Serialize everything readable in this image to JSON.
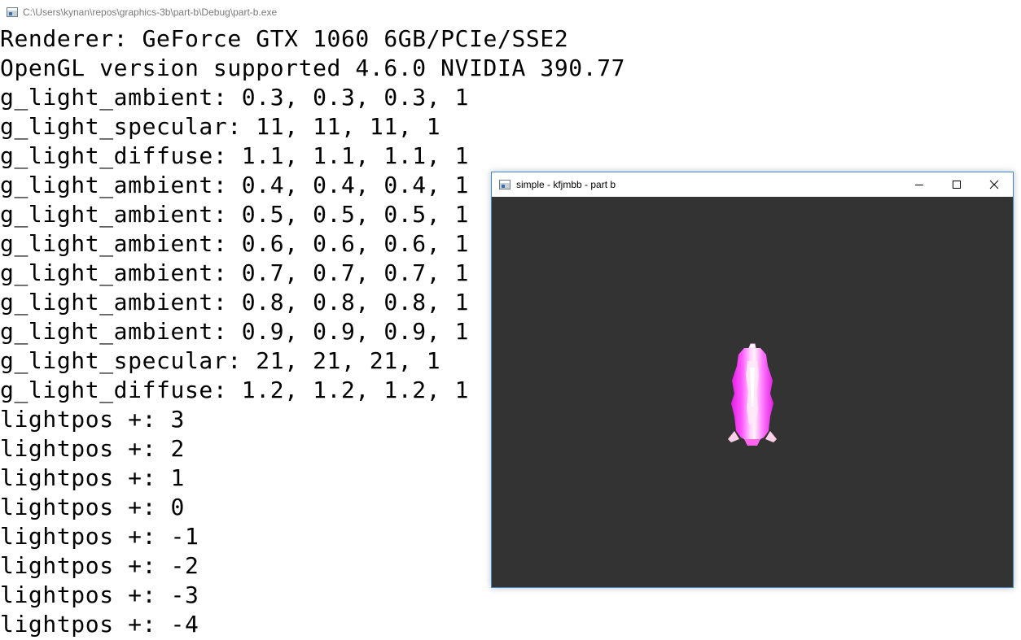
{
  "console": {
    "title": "C:\\Users\\kynan\\repos\\graphics-3b\\part-b\\Debug\\part-b.exe",
    "lines": [
      "Renderer: GeForce GTX 1060 6GB/PCIe/SSE2",
      "OpenGL version supported 4.6.0 NVIDIA 390.77",
      "g_light_ambient: 0.3, 0.3, 0.3, 1",
      "g_light_specular: 11, 11, 11, 1",
      "g_light_diffuse: 1.1, 1.1, 1.1, 1",
      "g_light_ambient: 0.4, 0.4, 0.4, 1",
      "g_light_ambient: 0.5, 0.5, 0.5, 1",
      "g_light_ambient: 0.6, 0.6, 0.6, 1",
      "g_light_ambient: 0.7, 0.7, 0.7, 1",
      "g_light_ambient: 0.8, 0.8, 0.8, 1",
      "g_light_ambient: 0.9, 0.9, 0.9, 1",
      "g_light_specular: 21, 21, 21, 1",
      "g_light_diffuse: 1.2, 1.2, 1.2, 1",
      "lightpos +: 3",
      "lightpos +: 2",
      "lightpos +: 1",
      "lightpos +: 0",
      "lightpos +: -1",
      "lightpos +: -2",
      "lightpos +: -3",
      "lightpos +: -4"
    ]
  },
  "gl_window": {
    "title": "simple - kfjmbb - part b",
    "buttons": {
      "minimize_icon": "minimize-icon",
      "maximize_icon": "maximize-icon",
      "close_icon": "close-icon"
    },
    "viewport_color": "#333333",
    "object_color": "#ff33ff",
    "accent_border": "#3c86d4"
  }
}
